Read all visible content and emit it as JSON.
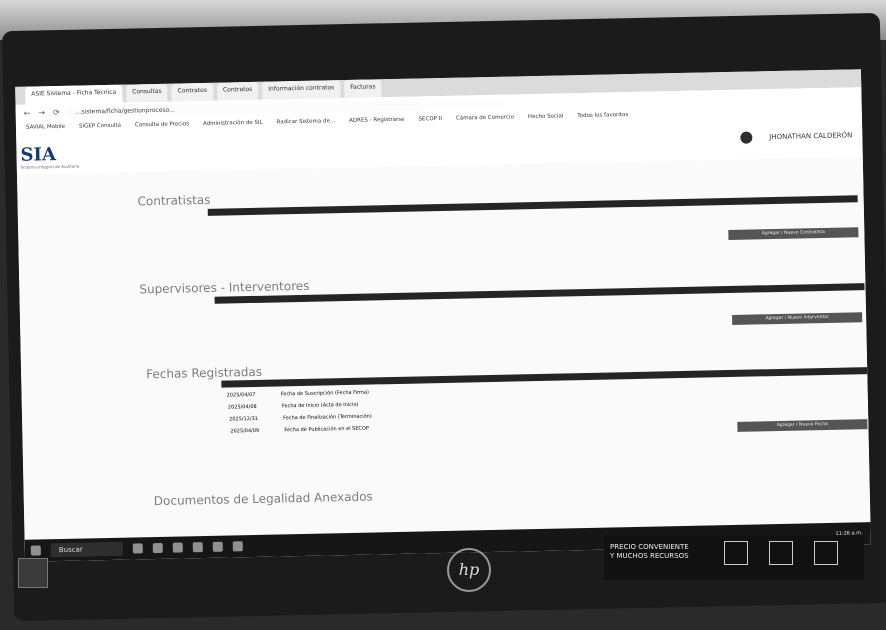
{
  "browser": {
    "tabs": [
      "ASIE Sistema - Ficha Técnica",
      "Consultas",
      "Contratos",
      "Contratos",
      "Información contratos",
      "Facturas"
    ],
    "url": "...sistema/ficha/gestionproceso...",
    "bookmarks": [
      "SAVIAL Mobile",
      "SIGEP Consulta",
      "Consulta de Precios",
      "Administración de SIL",
      "Radicar Sistema de...",
      "ADRES - Registrarse",
      "SECOP II",
      "Cámara de Comercio",
      "Hecho Social",
      "Todos los favoritos"
    ]
  },
  "app": {
    "logo": "SIA",
    "logo_sub": "Sistema Integral de Auditoría",
    "user": "JHONATHAN CALDERÓN"
  },
  "sections": {
    "contratistas": "Contratistas",
    "supervisores": "Supervisores - Interventores",
    "fechas": "Fechas Registradas",
    "documentos": "Documentos de Legalidad Anexados"
  },
  "fechas_rows": [
    {
      "date": "2025/04/07",
      "label": "Fecha de Suscripción (Fecha Firma)"
    },
    {
      "date": "2025/04/08",
      "label": "Fecha de Inicio (Acta de Inicio)"
    },
    {
      "date": "2025/12/31",
      "label": "Fecha de Finalización (Terminación)"
    },
    {
      "date": "2025/04/09",
      "label": "Fecha de Publicación en el SECOP"
    }
  ],
  "buttons": {
    "contratistas": "Agregar / Nuevo Contratista",
    "supervisores": "Agregar / Nuevo Interventor",
    "fechas": "Agregar / Nueva Fecha"
  },
  "taskbar": {
    "search": "Buscar",
    "clock": "11:26 a.m."
  },
  "sticker": {
    "line1": "PRECIO CONVENIENTE",
    "line2": "Y MUCHOS RECURSOS",
    "hp": "hp"
  }
}
